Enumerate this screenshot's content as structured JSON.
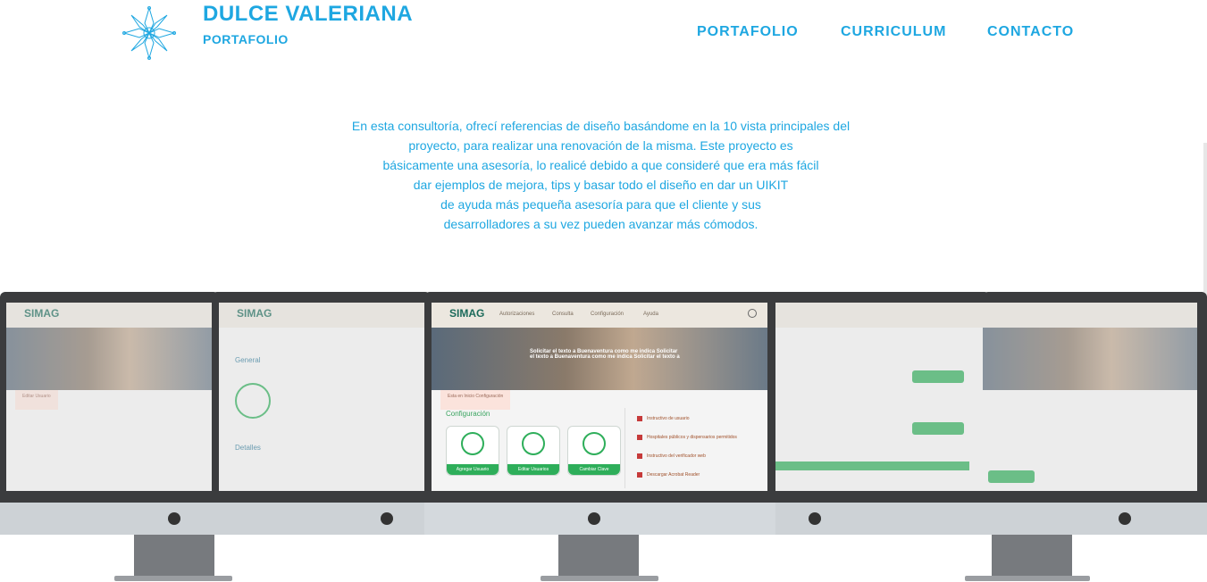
{
  "brand": {
    "name": "DULCE VALERIANA",
    "subtitle": "PORTAFOLIO"
  },
  "nav": {
    "items": [
      "PORTAFOLIO",
      "CURRICULUM",
      "CONTACTO"
    ]
  },
  "description": {
    "lines": [
      "En esta consultoría, ofrecí referencias de diseño basándome en la 10 vista principales del",
      "proyecto, para realizar una renovación de la misma. Este proyecto es",
      "básicamente una asesoría, lo realicé debido a que consideré que era más fácil",
      "dar ejemplos de mejora, tips y basar todo el diseño en dar un UIKIT",
      "de ayuda más pequeña asesoría para que el cliente y sus",
      "desarrolladores  a su vez pueden avanzar más cómodos."
    ]
  },
  "mockup": {
    "app_logo": "SIMAG",
    "menu": [
      "Autorizaciones",
      "Consulta",
      "Configuración",
      "Ayuda"
    ],
    "hero_text": "Solicitar el texto a Buenaventura como me indica Solicitar el texto a Buenaventura como me indica Solicitar el texto a",
    "tabs": "Esta en   Inicio   Configuración",
    "section_title": "Configuración",
    "cards": [
      "Agregar Usuario",
      "Editar Usuarios",
      "Cambiar Clave"
    ],
    "links": [
      "Instructivo de usuario",
      "Hospitales públicos y dispensarios permitidos",
      "Instructivo del verificador web",
      "Descargar Acrobat Reader"
    ]
  },
  "colors": {
    "accent": "#1ea7e1",
    "green": "#2eae5a",
    "bezel": "#3b3c3e"
  }
}
